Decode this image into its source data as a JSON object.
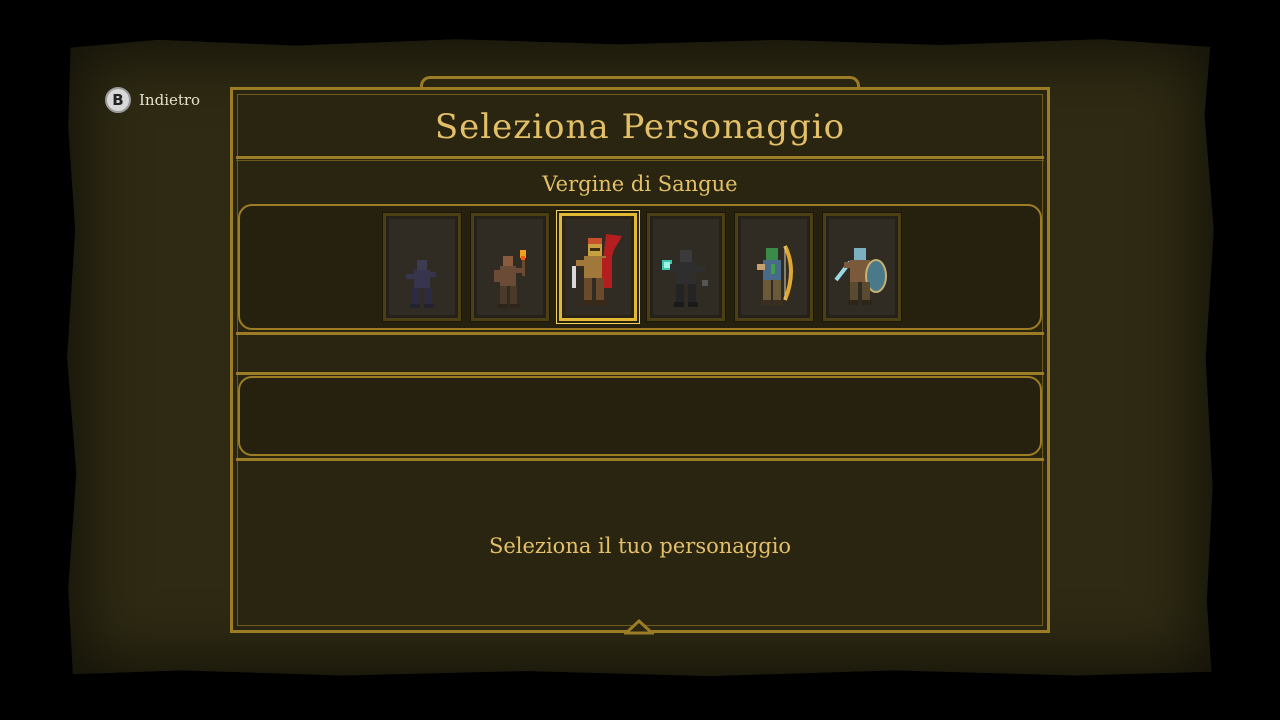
{
  "back": {
    "icon": "B",
    "label": "Indietro"
  },
  "header": {
    "title": "Seleziona Personaggio",
    "selected_name": "Vergine di Sangue"
  },
  "characters": [
    {
      "icon": "ninja-character-icon",
      "selected": false
    },
    {
      "icon": "torchbearer-character-icon",
      "selected": false
    },
    {
      "icon": "blood-maiden-character-icon",
      "selected": true
    },
    {
      "icon": "dark-knight-character-icon",
      "selected": false
    },
    {
      "icon": "archer-character-icon",
      "selected": false
    },
    {
      "icon": "shield-warrior-character-icon",
      "selected": false
    }
  ],
  "info": {
    "description": "Seleziona il tuo personaggio"
  },
  "colors": {
    "gold": "#e3c067",
    "frame": "#9c7d25",
    "background": "#2e2a13",
    "selected": "#e1b932"
  }
}
